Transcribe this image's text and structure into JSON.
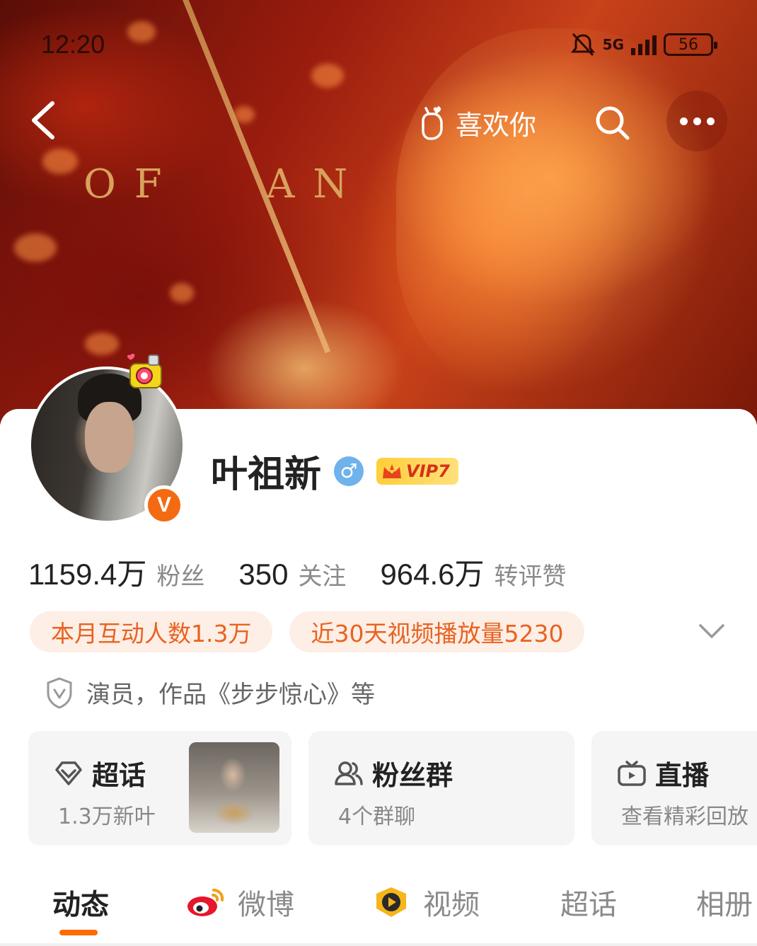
{
  "status_bar": {
    "time": "12:20",
    "network": "5G",
    "battery": "56"
  },
  "banner": {
    "text_left": "O F",
    "text_right": "A N"
  },
  "nav": {
    "like_label": "喜欢你"
  },
  "profile": {
    "name": "叶祖新",
    "gender_symbol": "♂",
    "vip_label": "VIP7",
    "verified_mark": "V"
  },
  "stats": [
    {
      "value": "1159.4万",
      "label": "粉丝"
    },
    {
      "value": "350",
      "label": "关注"
    },
    {
      "value": "964.6万",
      "label": "转评赞"
    }
  ],
  "highlights": [
    "本月互动人数1.3万",
    "近30天视频播放量5230"
  ],
  "intro": "演员，作品《步步惊心》等",
  "tiles": [
    {
      "title": "超话",
      "subtitle": "1.3万新叶",
      "icon": "supertopic-icon"
    },
    {
      "title": "粉丝群",
      "subtitle": "4个群聊",
      "icon": "group-icon"
    },
    {
      "title": "直播",
      "subtitle": "查看精彩回放",
      "icon": "live-tv-icon"
    }
  ],
  "tabs": [
    {
      "label": "动态",
      "active": true
    },
    {
      "label": "微博",
      "icon": "weibo-logo-icon"
    },
    {
      "label": "视频",
      "icon": "video-badge-icon"
    },
    {
      "label": "超话"
    },
    {
      "label": "相册"
    }
  ],
  "colors": {
    "accent": "#FF6A00",
    "pill_bg": "#FDEEE6",
    "pill_text": "#E8631F",
    "tile_bg": "#F5F5F5",
    "verified": "#F36A12"
  }
}
